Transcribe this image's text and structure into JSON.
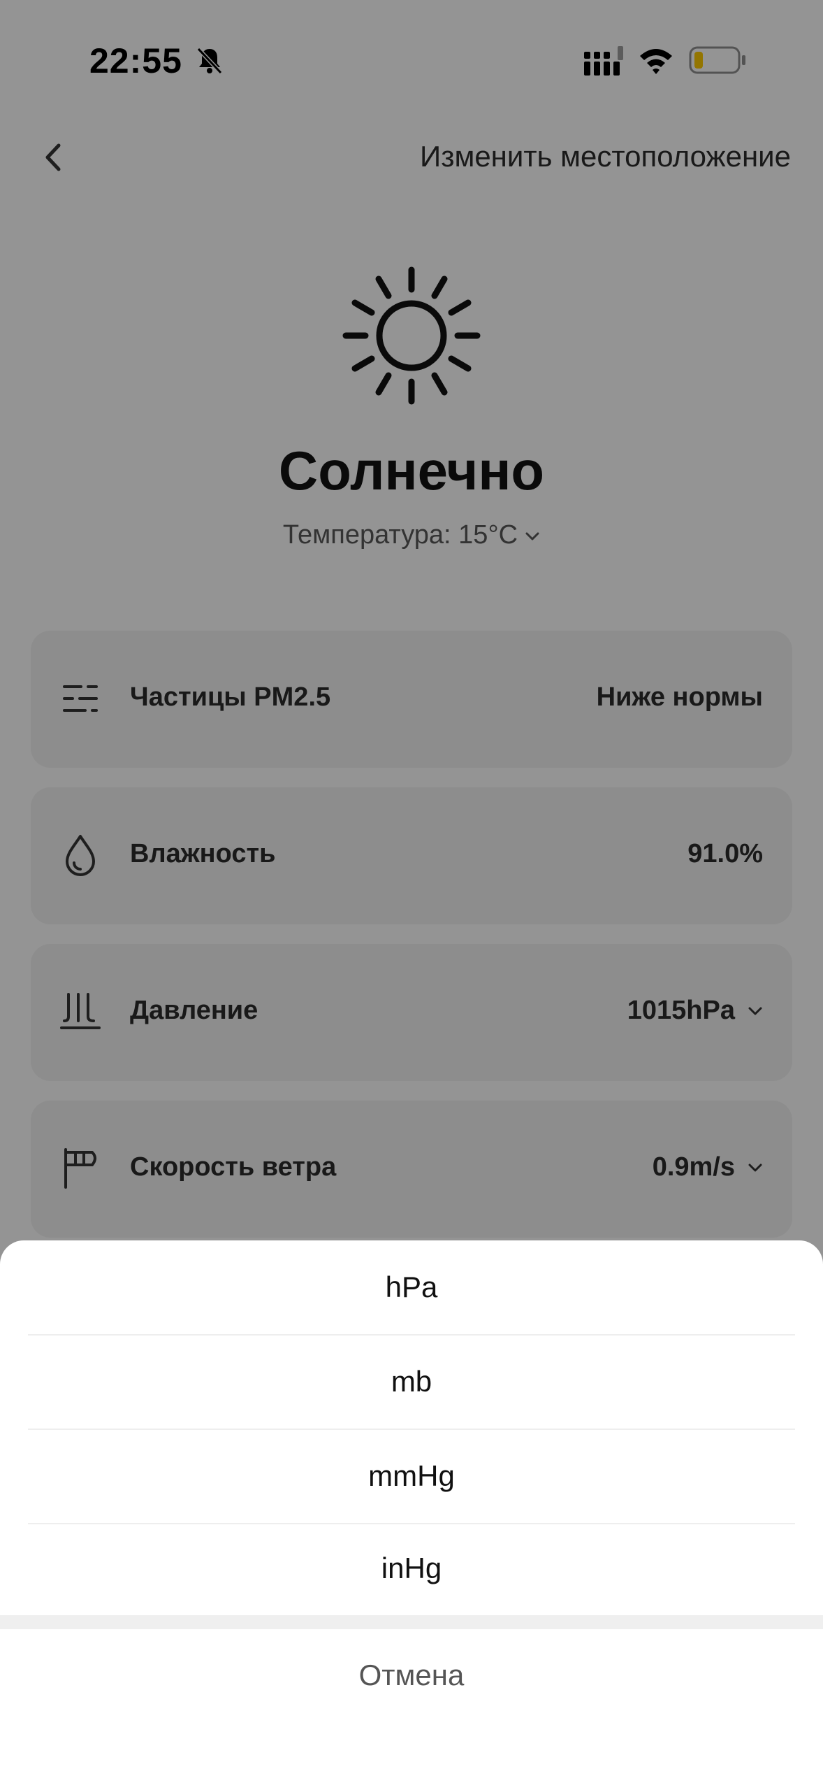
{
  "status_bar": {
    "time": "22:55"
  },
  "header": {
    "title": "Изменить местоположение"
  },
  "weather": {
    "condition": "Солнечно",
    "temperature": "Температура: 15°C"
  },
  "details": [
    {
      "label": "Частицы PM2.5",
      "value": "Ниже нормы",
      "icon": "particles-icon"
    },
    {
      "label": "Влажность",
      "value": "91.0%",
      "icon": "droplet-icon"
    },
    {
      "label": "Давление",
      "value": "1015hPa",
      "icon": "pressure-icon"
    },
    {
      "label": "Скорость ветра",
      "value": "0.9m/s",
      "icon": "wind-flag-icon"
    }
  ],
  "sheet": {
    "options": [
      "hPa",
      "mb",
      "mmHg",
      "inHg"
    ],
    "cancel": "Отмена"
  }
}
